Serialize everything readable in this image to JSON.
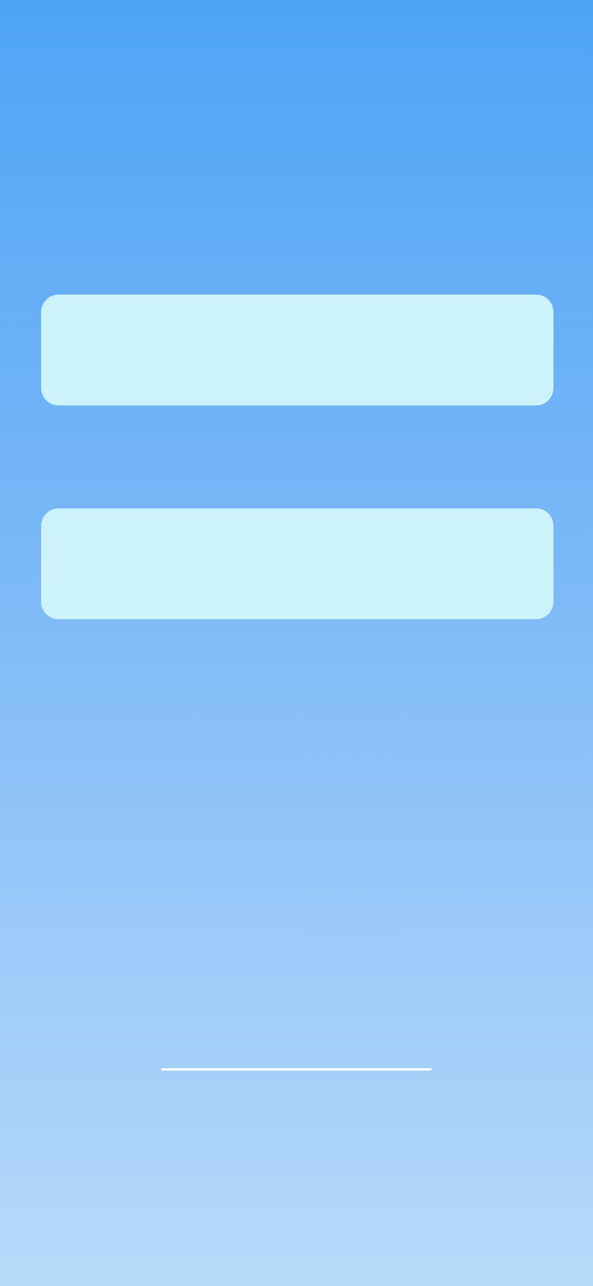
{
  "screen": {
    "background_colors": [
      "#4fa4f6",
      "#b7daf9"
    ],
    "card_color": "#ccf2fa",
    "indicator_color": "#ffffff"
  },
  "cards": [
    {
      "label": ""
    },
    {
      "label": ""
    }
  ]
}
